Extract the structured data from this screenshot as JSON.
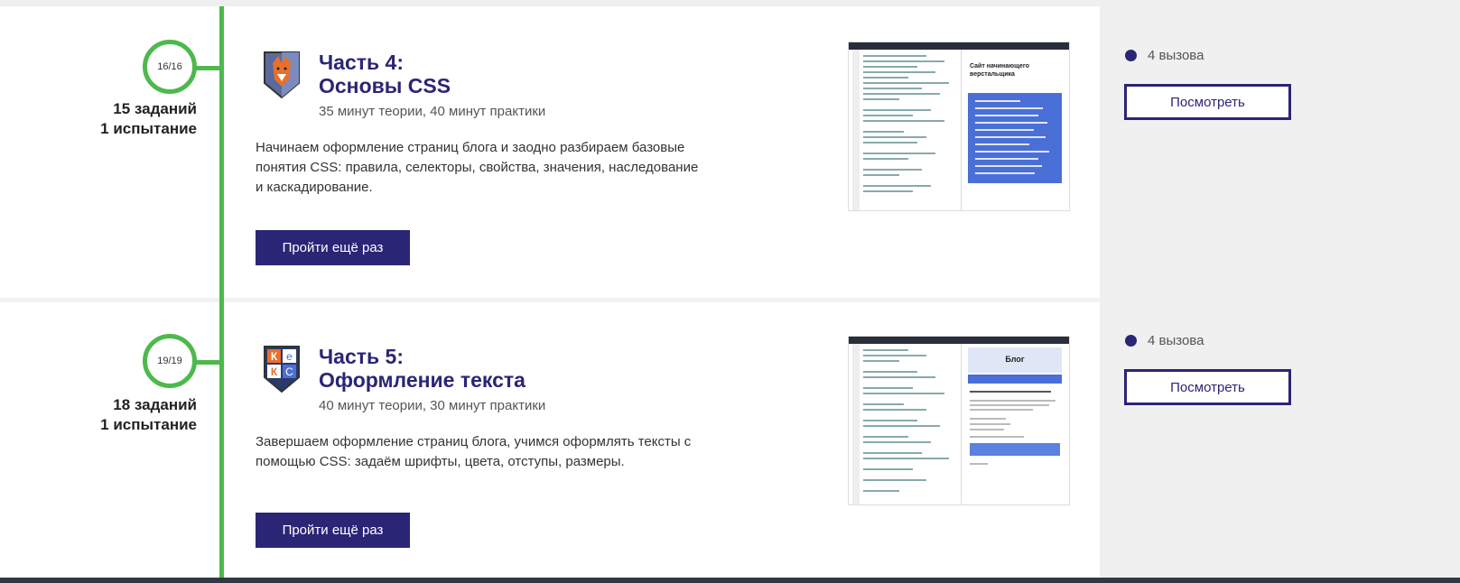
{
  "parts": [
    {
      "progress": "16/16",
      "tasks": "15 заданий",
      "trials": "1 испытание",
      "title_line1": "Часть 4:",
      "title_line2": "Основы CSS",
      "duration": "35 минут теории, 40 минут практики",
      "description": "Начинаем оформление страниц блога и заодно разбираем базовые понятия CSS: правила, селекторы, свойства, значения, наследование и каскадирование.",
      "retry_label": "Пройти ещё раз",
      "preview_title": "Сайт начинающего верстальщика",
      "logo_icon": "fox-shield-icon",
      "calls": "4 вызова",
      "view_label": "Посмотреть"
    },
    {
      "progress": "19/19",
      "tasks": "18 заданий",
      "trials": "1 испытание",
      "title_line1": "Часть 5:",
      "title_line2": "Оформление текста",
      "duration": "40 минут теории, 30 минут практики",
      "description": "Завершаем оформление страниц блога, учимся оформлять тексты с помощью CSS: задаём шрифты, цвета, отступы, размеры.",
      "retry_label": "Пройти ещё раз",
      "preview_title": "Блог",
      "logo_icon": "keks-shield-icon",
      "logo_letters": [
        "К",
        "е",
        "К",
        "С"
      ],
      "calls": "4 вызова",
      "view_label": "Посмотреть"
    }
  ],
  "colors": {
    "accent": "#2b2576",
    "timeline": "#4db94d",
    "sidebar_bg": "#f0f0f0"
  }
}
